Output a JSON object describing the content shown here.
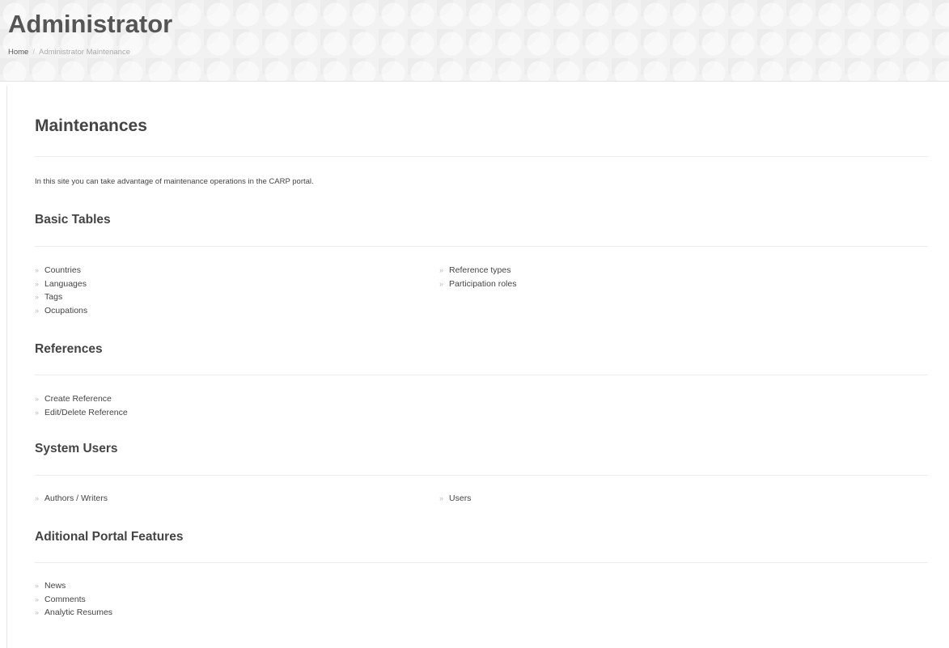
{
  "header": {
    "title": "Administrator",
    "breadcrumb": {
      "home": "Home",
      "separator": "/",
      "current": "Administrator Maintenance"
    }
  },
  "main": {
    "title": "Maintenances",
    "intro": "In this site you can take advantage of maintenance operations in the CARP portal.",
    "arrow_icon": "»",
    "sections": {
      "basic_tables": {
        "title": "Basic Tables",
        "left": [
          "Countries",
          "Languages",
          "Tags",
          "Ocupations"
        ],
        "right": [
          "Reference types",
          "Participation roles"
        ]
      },
      "references": {
        "title": "References",
        "left": [
          "Create Reference",
          "Edit/Delete Reference"
        ]
      },
      "system_users": {
        "title": "System Users",
        "left": [
          "Authors / Writers"
        ],
        "right": [
          "Users"
        ]
      },
      "additional_features": {
        "title": "Aditional Portal Features",
        "left": [
          "News",
          "Comments",
          "Analytic Resumes"
        ]
      }
    }
  }
}
